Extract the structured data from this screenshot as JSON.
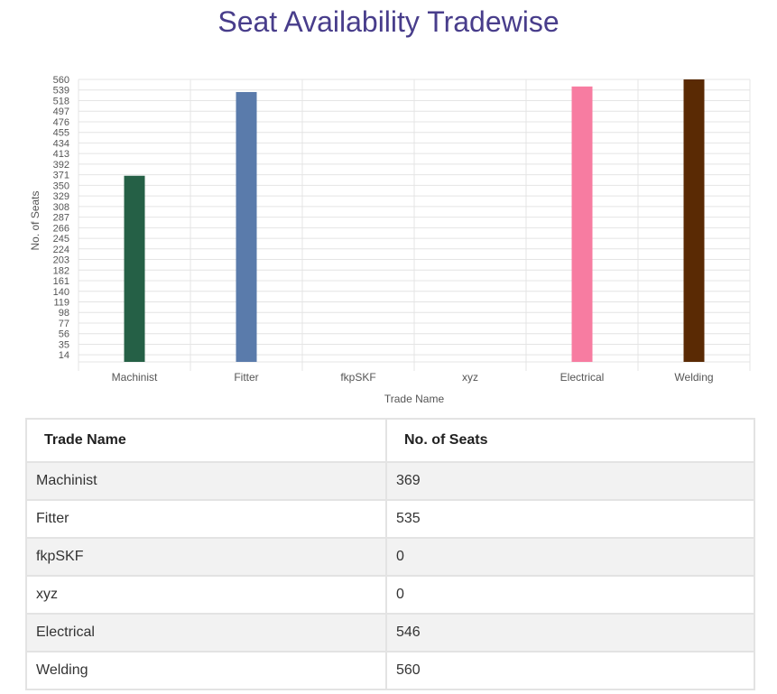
{
  "page": {
    "title": "Seat Availability Tradewise"
  },
  "chart_data": {
    "type": "bar",
    "title": "",
    "xlabel": "Trade Name",
    "ylabel": "No. of Seats",
    "categories": [
      "Machinist",
      "Fitter",
      "fkpSKF",
      "xyz",
      "Electrical",
      "Welding"
    ],
    "values": [
      369,
      535,
      0,
      0,
      546,
      560
    ],
    "colors": [
      "#256046",
      "#5a7bab",
      "#2e8b57",
      "#6b5b95",
      "#f77ca1",
      "#5a2a04"
    ],
    "yticks": [
      14,
      35,
      56,
      77,
      98,
      119,
      140,
      161,
      182,
      203,
      224,
      245,
      266,
      287,
      308,
      329,
      350,
      371,
      392,
      413,
      434,
      455,
      476,
      497,
      518,
      539,
      560
    ],
    "ylim": [
      0,
      560
    ],
    "grid": true,
    "legend": "none"
  },
  "table": {
    "headers": [
      "Trade Name",
      "No. of Seats"
    ],
    "rows": [
      [
        "Machinist",
        "369"
      ],
      [
        "Fitter",
        "535"
      ],
      [
        "fkpSKF",
        "0"
      ],
      [
        "xyz",
        "0"
      ],
      [
        "Electrical",
        "546"
      ],
      [
        "Welding",
        "560"
      ]
    ]
  }
}
